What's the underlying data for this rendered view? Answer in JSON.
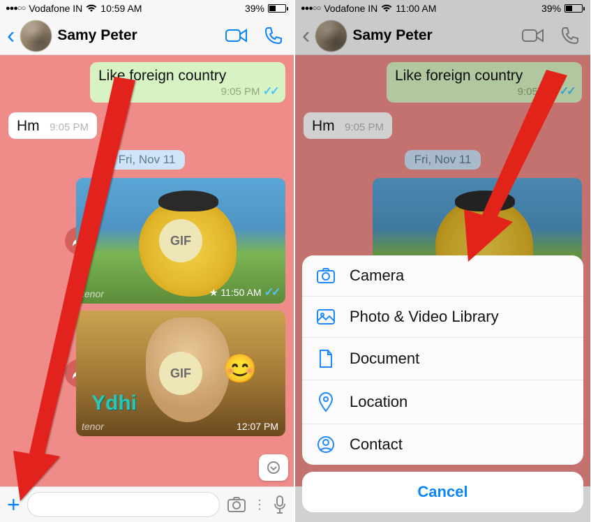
{
  "status": {
    "carrier": "Vodafone IN",
    "time_left": "10:59 AM",
    "time_right": "11:00 AM",
    "battery_pct": "39%",
    "battery_fill": 39
  },
  "contact": {
    "name": "Samy Peter"
  },
  "chat": {
    "out1_text": "Like foreign country",
    "out1_time": "9:05 PM",
    "in1_text": "Hm",
    "in1_time": "9:05 PM",
    "date_chip": "Fri, Nov 11",
    "gif_label": "GIF",
    "media1_time": "11:50 AM",
    "media1_src": "tenor",
    "media2_time": "12:07 PM",
    "media2_src": "tenor",
    "media2_overlay": "Ydhi"
  },
  "sheet": {
    "camera": "Camera",
    "library": "Photo & Video Library",
    "document": "Document",
    "location": "Location",
    "contact": "Contact",
    "cancel": "Cancel"
  }
}
